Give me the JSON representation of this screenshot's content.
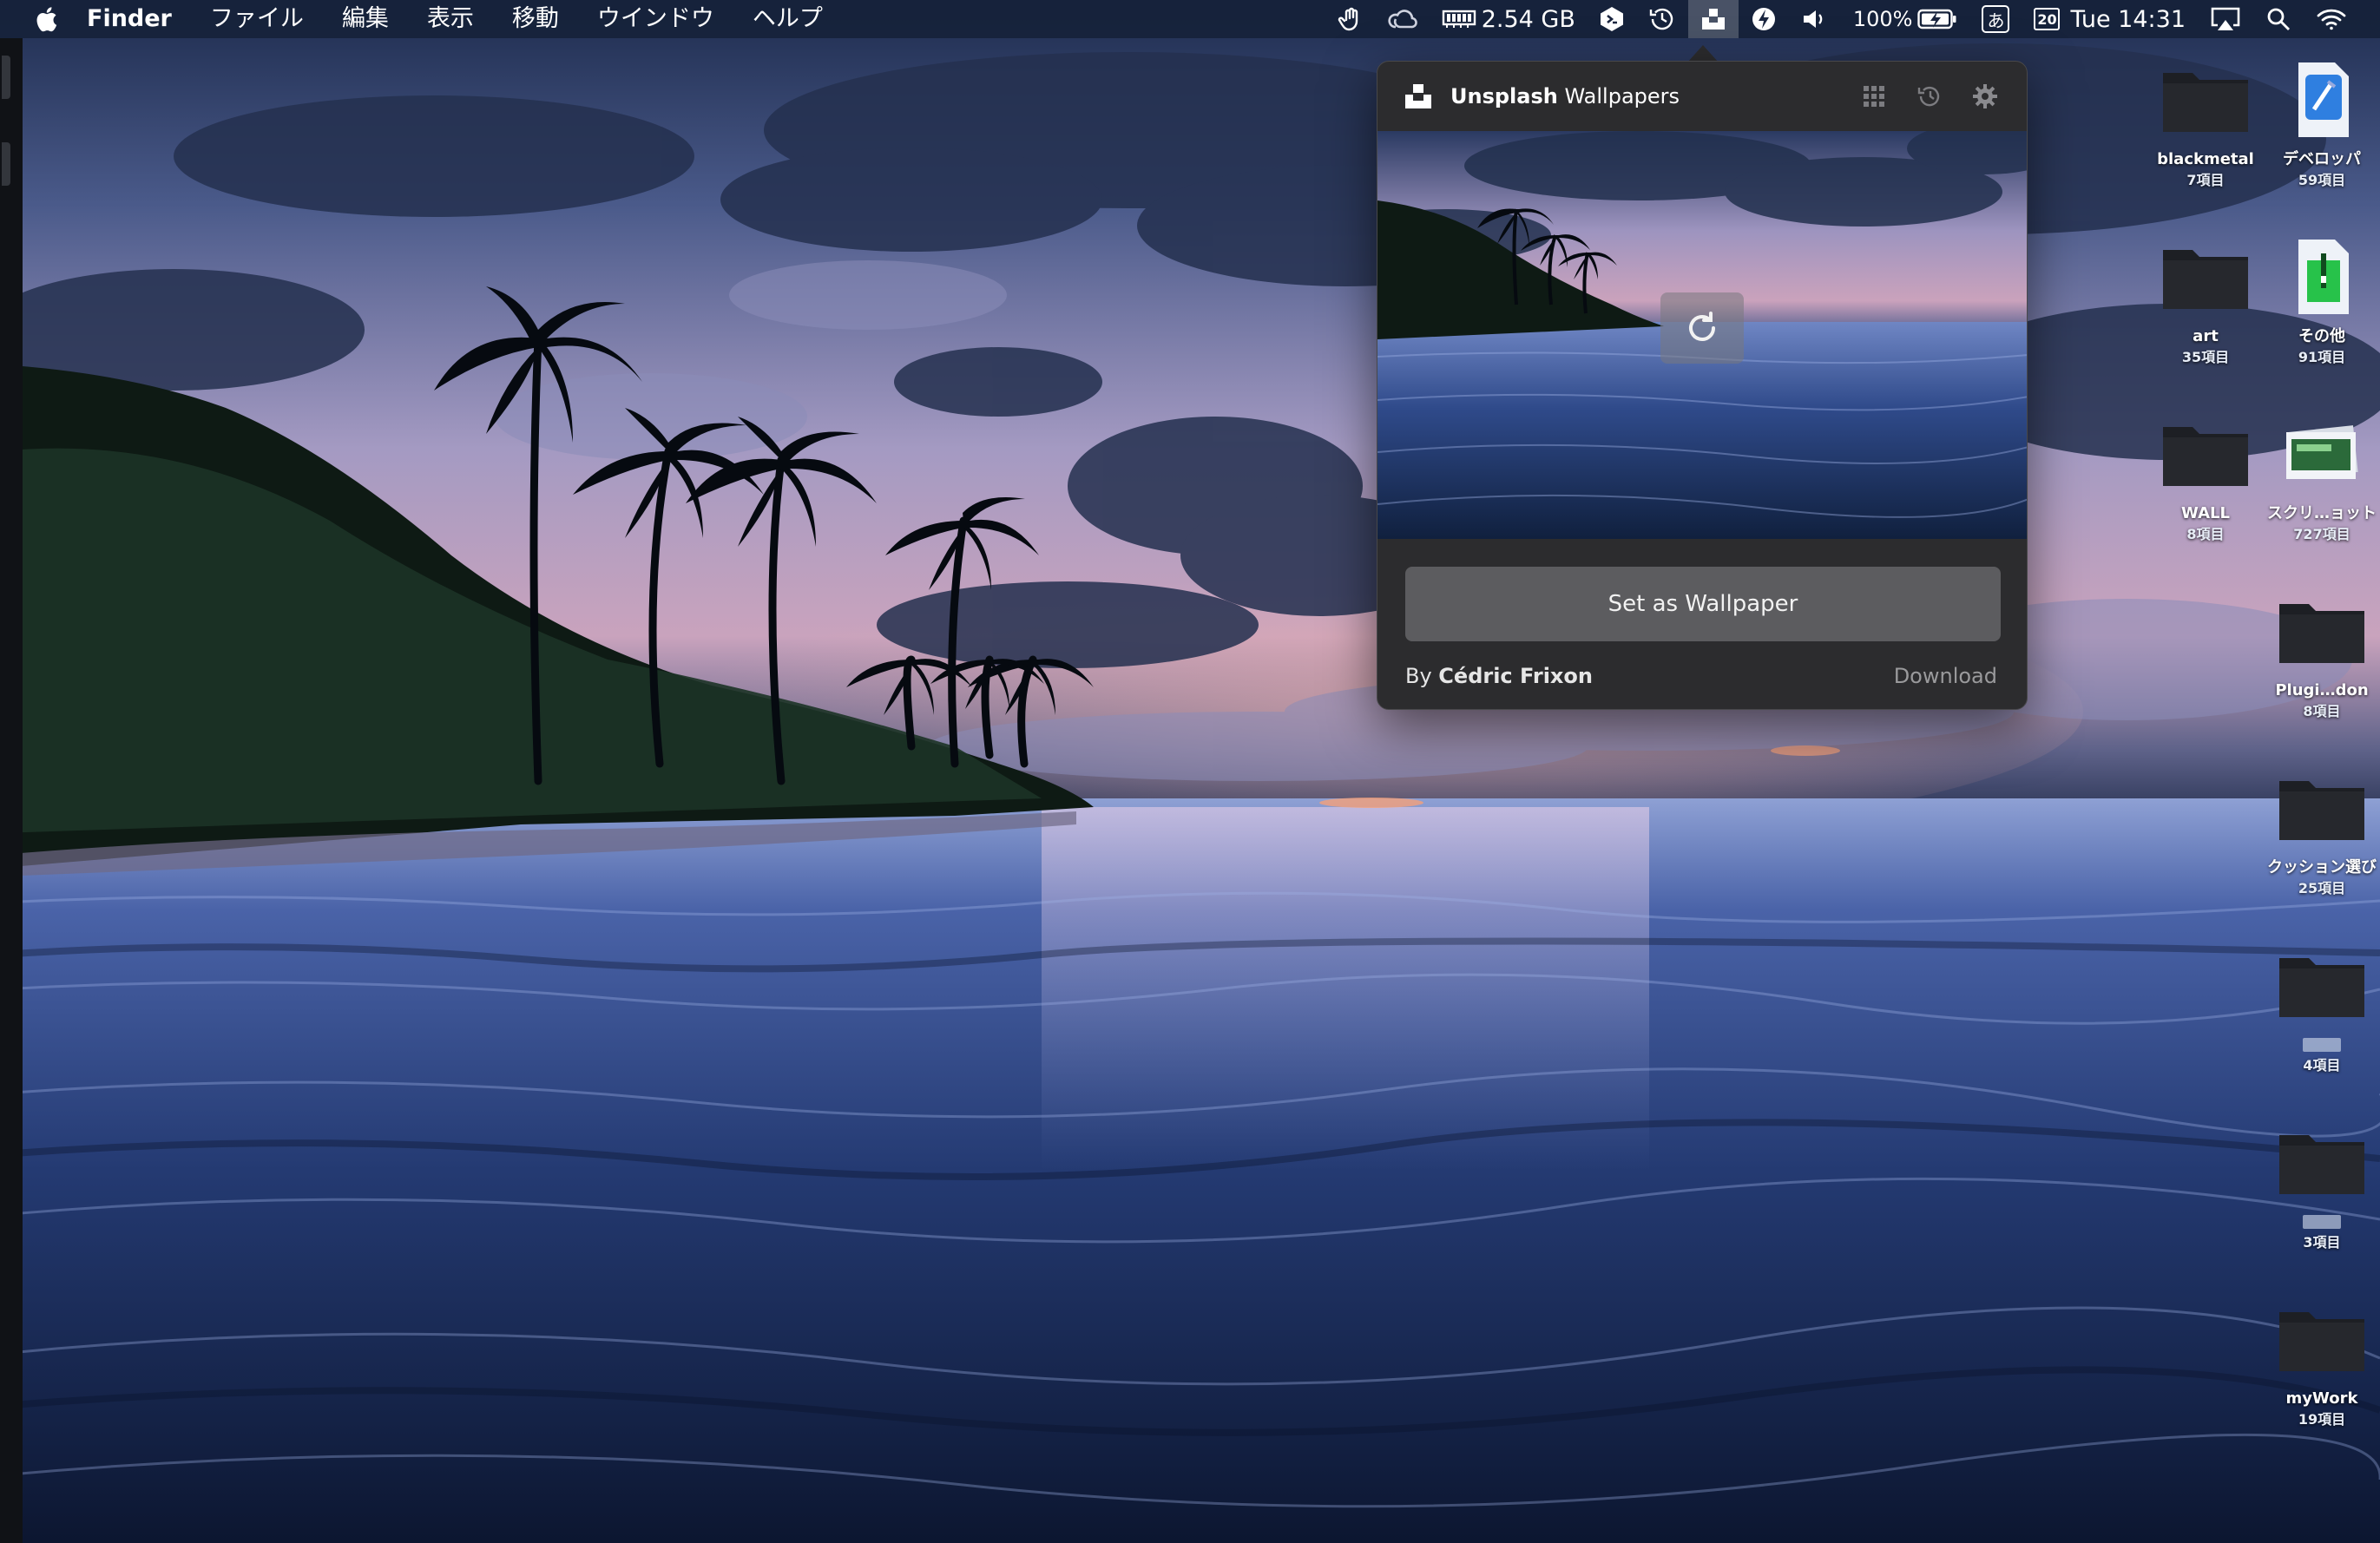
{
  "menubar": {
    "app_name": "Finder",
    "menus": [
      "ファイル",
      "編集",
      "表示",
      "移動",
      "ウインドウ",
      "ヘルプ"
    ],
    "memory": "2.54 GB",
    "volume_percent_label": "100%",
    "ime_label": "あ",
    "calendar_day": "20",
    "clock": "Tue 14:31"
  },
  "popover": {
    "title_bold": "Unsplash",
    "title_rest": " Wallpapers",
    "set_wallpaper_label": "Set as Wallpaper",
    "by_prefix": "By ",
    "author": "Cédric Frixon",
    "download_label": "Download"
  },
  "desktop": {
    "items": [
      {
        "name": "blackmetal",
        "count": "7項目"
      },
      {
        "name": "デベロッパ",
        "count": "59項目"
      },
      {
        "name": "art",
        "count": "35項目"
      },
      {
        "name": "その他",
        "count": "91項目"
      },
      {
        "name": "WALL",
        "count": "8項目"
      },
      {
        "name": "スクリ…ョット",
        "count": "727項目"
      },
      {
        "name": "Plugi…don",
        "count": "8項目"
      },
      {
        "name": "クッション選び",
        "count": "25項目"
      },
      {
        "name": "",
        "count": "4項目"
      },
      {
        "name": "",
        "count": "3項目"
      },
      {
        "name": "myWork",
        "count": "19項目"
      }
    ]
  }
}
